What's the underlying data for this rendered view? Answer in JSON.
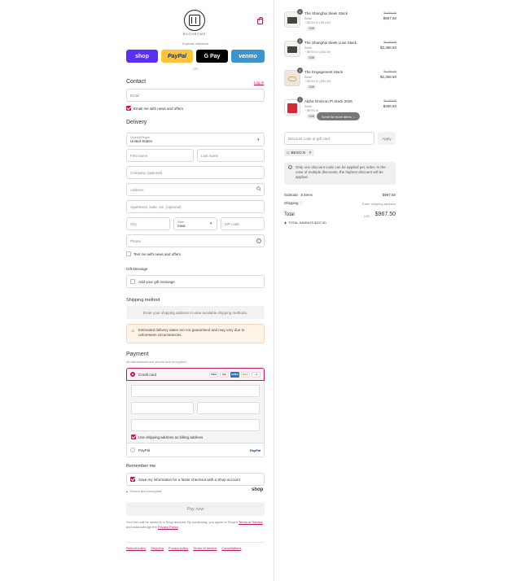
{
  "header": {
    "brand": "BUONHOME",
    "express": "Express checkout",
    "or": "OR"
  },
  "express_buttons": [
    "shop",
    "PayPal",
    "G Pay",
    "venmo"
  ],
  "contact": {
    "title": "Contact",
    "login": "Log in",
    "email_placeholder": "Email",
    "email_news": "Email me with news and offers"
  },
  "delivery": {
    "title": "Delivery",
    "country_label": "Country/Region",
    "country_value": "United States",
    "first_name": "First name",
    "last_name": "Last name",
    "company": "Company (optional)",
    "address": "Address",
    "apartment": "Apartment, suite, etc. (optional)",
    "city": "City",
    "state_label": "State",
    "state_value": "Iowa",
    "zip": "ZIP code",
    "phone": "Phone",
    "text_offers": "Text me with news and offers"
  },
  "gift": {
    "title": "Gift Message",
    "add": "Add your gift message"
  },
  "shipping": {
    "title": "Shipping method",
    "placeholder": "Enter your shipping address to view available shipping methods.",
    "warning": "Estimated delivery dates are not guaranteed and may vary due to unforeseen circumstances."
  },
  "payment": {
    "title": "Payment",
    "subtitle": "All transactions are secure and encrypted.",
    "credit_card": "Credit card",
    "card_logos": [
      "VISA",
      "MC",
      "AMEX",
      "DISC"
    ],
    "more": "+4",
    "billing": "Use shipping address as billing address",
    "paypal": "PayPal",
    "paypal_logo": "PayPal"
  },
  "remember": {
    "title": "Remember me",
    "save": "Save my information for a faster checkout with a Shop account",
    "secure": "Secure and encrypted",
    "shop": "shop"
  },
  "pay_now": "Pay now",
  "legal": {
    "prefix": "Your info will be saved to a Shop account. By continuing, you agree to Shop's ",
    "terms": "Terms of Service",
    "middle": " and acknowledge the ",
    "privacy": "Privacy Policy",
    "suffix": "."
  },
  "footer_links": [
    "Refund policy",
    "Shipping",
    "Privacy policy",
    "Terms of service",
    "Cancellations"
  ],
  "cart": {
    "items": [
      {
        "qty": "1",
        "name": "The Shanghai Sleek Stack",
        "variant": "Small",
        "note": "BEGO.N (-$5,100)",
        "tag": "CBB",
        "old": "$1,050.00",
        "price": "$957.50"
      },
      {
        "qty": "1",
        "name": "The Shanghai Sleek Luxe Stack",
        "variant": "Small",
        "note": "BEGO.N (-$34.40)",
        "tag": "CBB",
        "old": "$1,450.00",
        "price": "$2,356.50"
      },
      {
        "qty": "1",
        "name": "The Engagement Stack",
        "variant": "Small",
        "note": "BEGO.N (-$34.40)",
        "tag": "CBB",
        "old": "$1,450.00",
        "price": "$2,356.50"
      },
      {
        "qty": "1",
        "name": "Alpha Omicron Pi Stack 2026",
        "variant": "Small",
        "note": "BEGO.N",
        "tag": "CBB",
        "old": "$1,450.00",
        "price": "$266.50"
      }
    ],
    "scroll_hint": "Scroll for more items",
    "discount_placeholder": "Discount code or gift card",
    "apply": "Apply",
    "code": "BEGO.N",
    "notice": "Only one discount code can be applied per order. In the case of multiple discounts, the highest discount will be applied.",
    "subtotal_label": "Subtotal · 5 items",
    "subtotal": "$967.50",
    "shipping_label": "Shipping",
    "shipping_value": "Enter shipping address",
    "total_label": "Total",
    "currency": "USD",
    "total": "$967.50",
    "savings": "TOTAL SAVINGS $107.50"
  },
  "colors": {
    "accent": "#c2185b",
    "shop": "#5a31f4",
    "paypal": "#ffc439",
    "gpay": "#000000",
    "venmo": "#3d95ce"
  }
}
